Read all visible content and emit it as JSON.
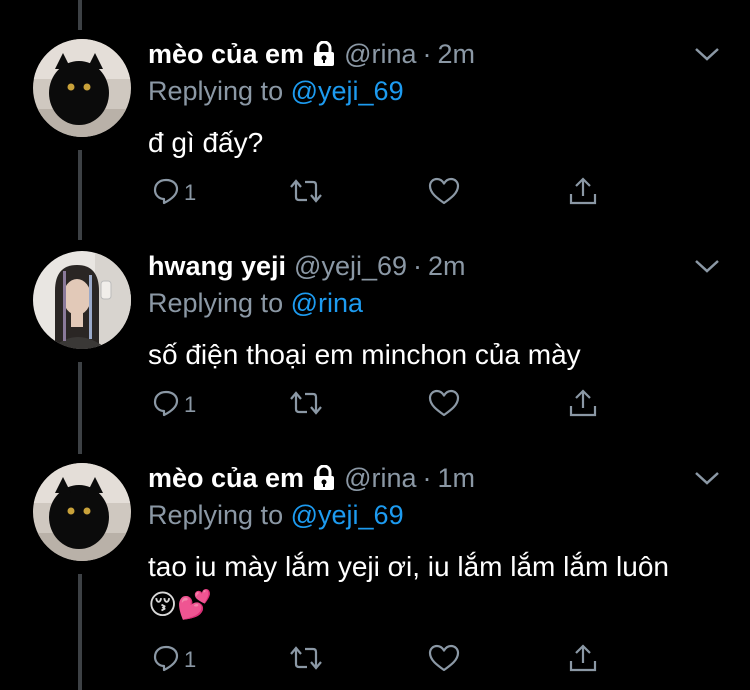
{
  "colors": {
    "background": "#000000",
    "name": "#ffffff",
    "secondary": "#8b98a5",
    "mention": "#1d9bf0",
    "thread_line": "#3d4145"
  },
  "tweets": [
    {
      "name": "mèo của em",
      "locked": true,
      "handle": "@rina",
      "dot": "·",
      "time": "2m",
      "replying_prefix": "Replying to",
      "replying_to": "@yeji_69",
      "text": "đ gì đấy?",
      "emoji": "",
      "reply_count": "1",
      "avatar": "black-cat-avatar"
    },
    {
      "name": "hwang yeji",
      "locked": false,
      "handle": "@yeji_69",
      "dot": "·",
      "time": "2m",
      "replying_prefix": "Replying to",
      "replying_to": "@rina",
      "text": "số điện thoại em minchon của mày",
      "emoji": "",
      "reply_count": "1",
      "avatar": "girl-photo-avatar"
    },
    {
      "name": "mèo của em",
      "locked": true,
      "handle": "@rina",
      "dot": "·",
      "time": "1m",
      "replying_prefix": "Replying to",
      "replying_to": "@yeji_69",
      "text": "tao iu mày lắm yeji ơi, iu lắm lắm lắm luôn",
      "emoji": "😚💕",
      "reply_count": "1",
      "avatar": "black-cat-avatar"
    }
  ],
  "icons": {
    "reply": "reply-icon",
    "retweet": "retweet-icon",
    "like": "heart-icon",
    "share": "share-icon",
    "more": "chevron-down-icon",
    "lock": "lock-icon"
  }
}
